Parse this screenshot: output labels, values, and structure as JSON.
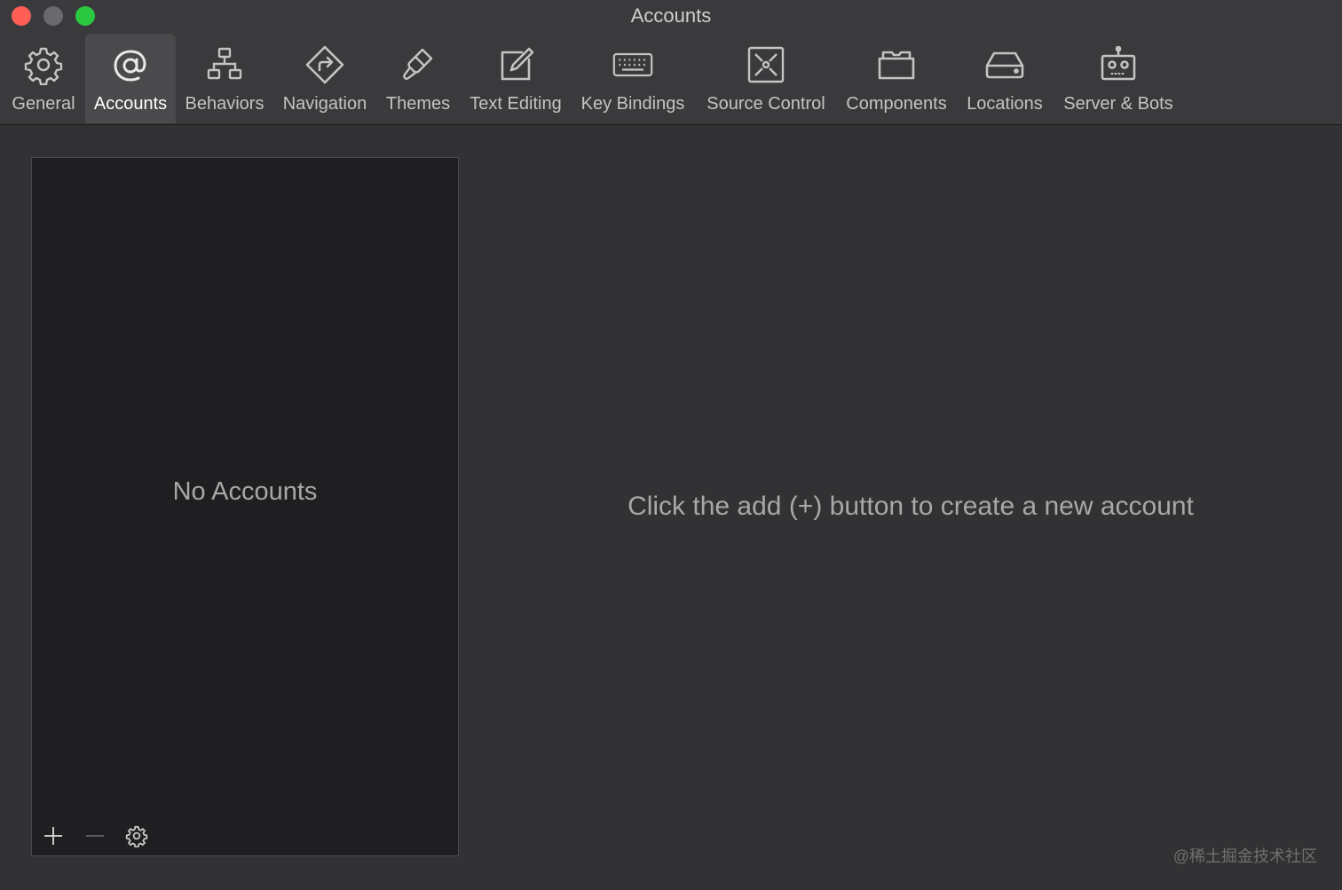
{
  "window": {
    "title": "Accounts"
  },
  "toolbar": {
    "items": [
      {
        "label": "General",
        "icon": "gear-icon"
      },
      {
        "label": "Accounts",
        "icon": "at-sign-icon"
      },
      {
        "label": "Behaviors",
        "icon": "hierarchy-icon"
      },
      {
        "label": "Navigation",
        "icon": "turn-right-sign-icon"
      },
      {
        "label": "Themes",
        "icon": "paintbrush-icon"
      },
      {
        "label": "Text Editing",
        "icon": "edit-square-icon"
      },
      {
        "label": "Key Bindings",
        "icon": "keyboard-icon"
      },
      {
        "label": "Source Control",
        "icon": "source-control-icon"
      },
      {
        "label": "Components",
        "icon": "box-icon"
      },
      {
        "label": "Locations",
        "icon": "drive-icon"
      },
      {
        "label": "Server & Bots",
        "icon": "robot-icon"
      }
    ],
    "selected": "Accounts"
  },
  "accounts_list": {
    "empty_label": "No Accounts",
    "footer": {
      "add_icon": "plus-icon",
      "remove_icon": "minus-icon",
      "settings_icon": "gear-icon"
    }
  },
  "detail": {
    "hint": "Click the add (+) button to create a new account"
  },
  "watermark": "@稀土掘金技术社区",
  "colors": {
    "close": "#ff5f57",
    "minimize": "#6a6a6c",
    "maximize": "#29c840",
    "toolbar_bg": "#3a3a3c",
    "content_bg": "#323234",
    "list_bg": "#1f1f21"
  }
}
